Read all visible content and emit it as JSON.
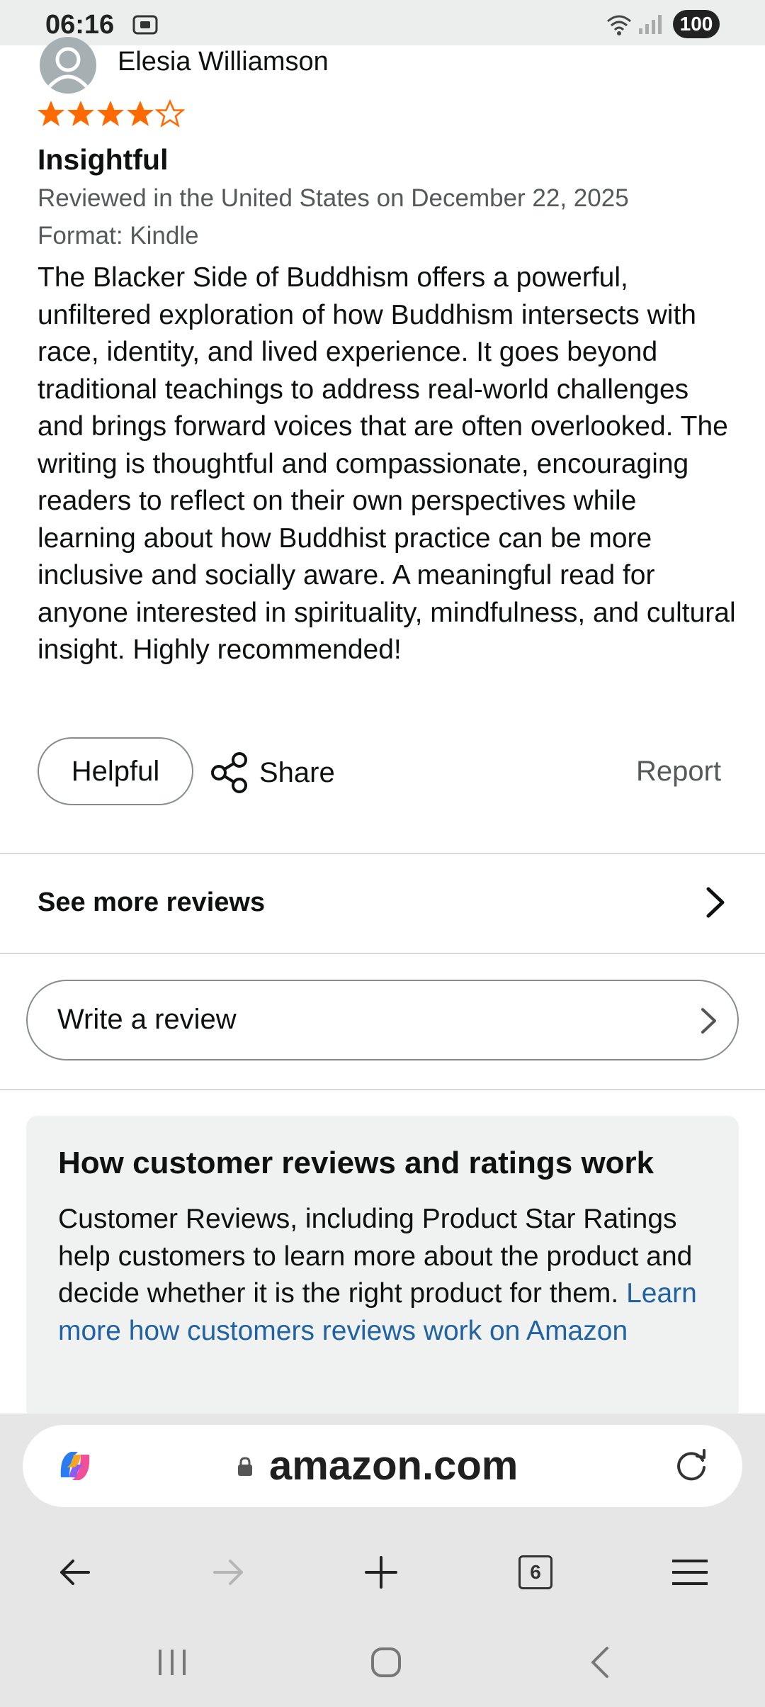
{
  "status_bar": {
    "time": "06:16",
    "battery": "100"
  },
  "review": {
    "reviewer_name": "Elesia Williamson",
    "rating": 4,
    "rating_max": 5,
    "title": "Insightful",
    "meta": "Reviewed in the United States on December 22, 2025",
    "format": "Format: Kindle",
    "body": "The Blacker Side of Buddhism offers a powerful, unfiltered exploration of how Buddhism intersects with race, identity, and lived experience. It goes beyond traditional teachings to address real-world challenges and brings forward voices that are often overlooked. The writing is thoughtful and compassionate, encouraging readers to reflect on their own perspectives while learning about how Buddhist practice can be more inclusive and socially aware. A meaningful read for anyone interested in spirituality, mindfulness, and cultural insight. Highly recommended!",
    "helpful_label": "Helpful",
    "share_label": "Share",
    "report_label": "Report"
  },
  "see_more_reviews": "See more reviews",
  "write_review": "Write a review",
  "info_box": {
    "title": "How customer reviews and ratings work",
    "body": "Customer Reviews, including Product Star Ratings help customers to learn more about the product and decide whether it is the right product for them. ",
    "link": "Learn more how customers reviews work on Amazon"
  },
  "browser": {
    "url": "amazon.com",
    "tab_count": "6"
  },
  "colors": {
    "star": "#ff6a00",
    "link": "#2162a1",
    "muted_text": "#565959"
  }
}
